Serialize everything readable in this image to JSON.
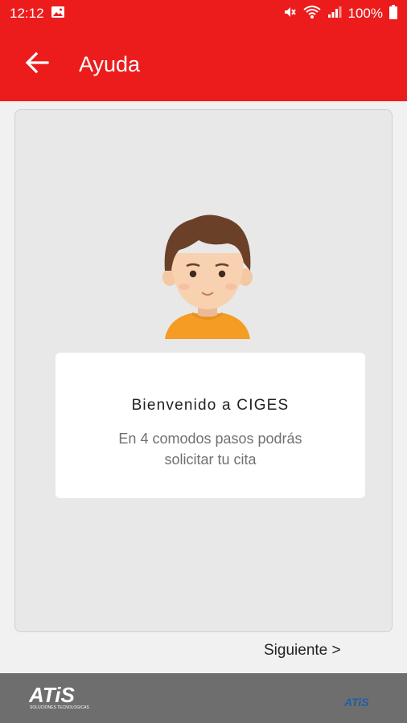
{
  "status_bar": {
    "time": "12:12",
    "battery": "100%",
    "icons": [
      "image-icon",
      "mute-icon",
      "wifi-icon",
      "signal-icon",
      "battery-icon"
    ]
  },
  "app_bar": {
    "title": "Ayuda",
    "back_icon": "arrow-left-icon",
    "color": "#ec1c1c"
  },
  "welcome": {
    "title": "Bienvenido a CIGES",
    "subtitle_line1": "En 4 comodos pasos podrás",
    "subtitle_line2": "solicitar tu cita"
  },
  "navigation": {
    "next_label": "Siguiente >"
  },
  "footer": {
    "logo_left": "ATiS",
    "logo_left_tagline": "SOLUCIONES TECNOLOGICAS",
    "logo_right": "ATiS",
    "color": "#6e6e6e"
  }
}
